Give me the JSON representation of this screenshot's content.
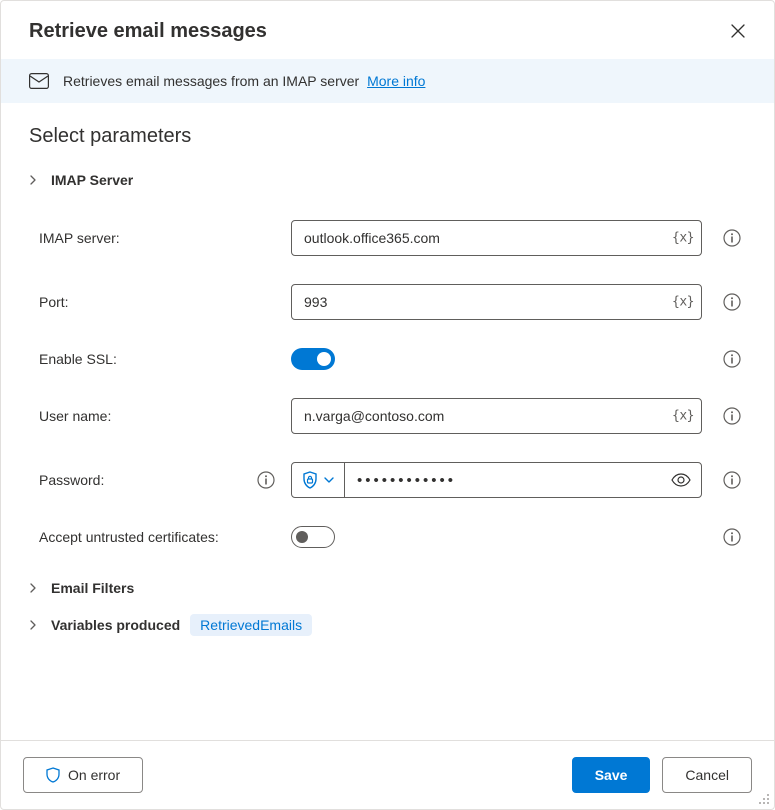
{
  "header": {
    "title": "Retrieve email messages"
  },
  "banner": {
    "text": "Retrieves email messages from an IMAP server",
    "more_info_label": "More info"
  },
  "section_heading": "Select parameters",
  "groups": {
    "imap": {
      "label": "IMAP Server"
    },
    "filters": {
      "label": "Email Filters"
    },
    "variables": {
      "label": "Variables produced",
      "chip": "RetrievedEmails"
    }
  },
  "fields": {
    "imap_server": {
      "label": "IMAP server:",
      "value": "outlook.office365.com",
      "fx": "{x}"
    },
    "port": {
      "label": "Port:",
      "value": "993",
      "fx": "{x}"
    },
    "enable_ssl": {
      "label": "Enable SSL:",
      "on": true
    },
    "username": {
      "label": "User name:",
      "value": "n.varga@contoso.com",
      "fx": "{x}"
    },
    "password": {
      "label": "Password:",
      "value": "••••••••••••"
    },
    "accept_untrusted": {
      "label": "Accept untrusted certificates:",
      "on": false
    }
  },
  "footer": {
    "on_error": "On error",
    "save": "Save",
    "cancel": "Cancel"
  }
}
